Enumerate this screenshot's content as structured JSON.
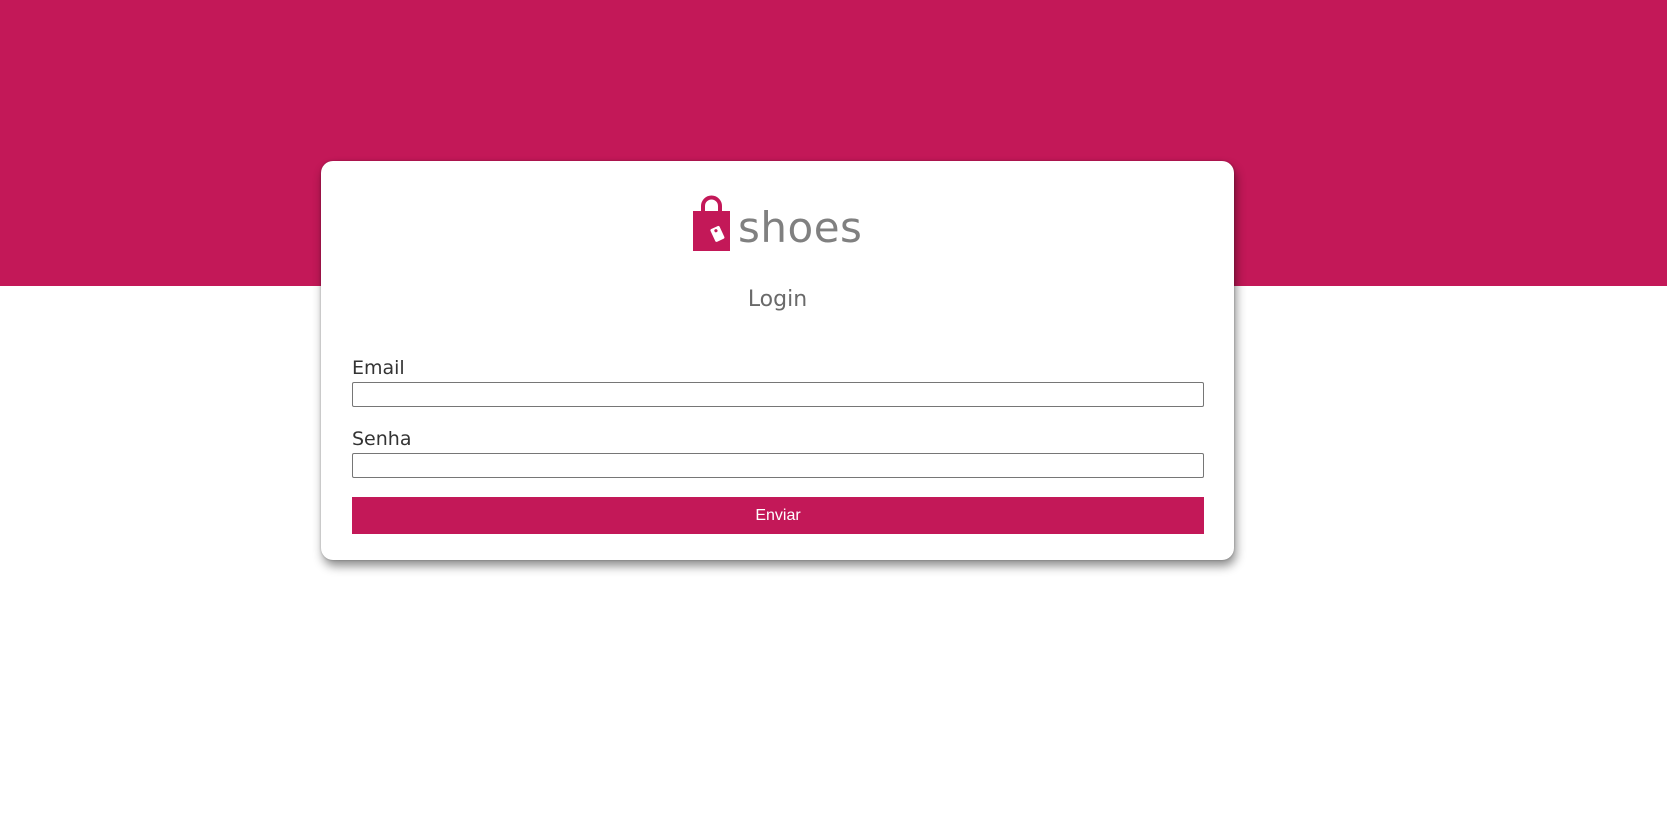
{
  "brand": {
    "name": "shoes",
    "icon": "shopping-bag-icon",
    "accent_color": "#c31858"
  },
  "form": {
    "title": "Login",
    "email_label": "Email",
    "email_value": "",
    "password_label": "Senha",
    "password_value": "",
    "submit_label": "Enviar"
  }
}
